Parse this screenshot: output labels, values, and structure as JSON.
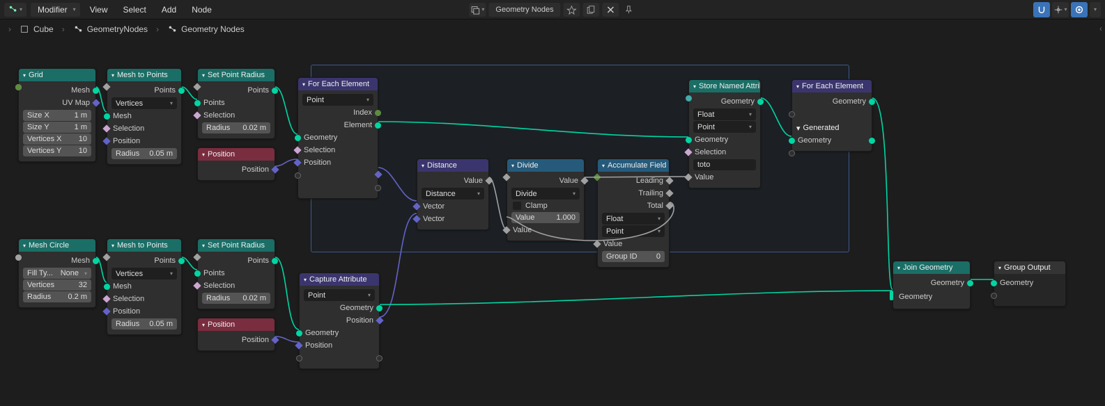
{
  "header": {
    "modifier_label": "Modifier",
    "menu": {
      "view": "View",
      "select": "Select",
      "add": "Add",
      "node": "Node"
    },
    "datablock": "Geometry Nodes"
  },
  "breadcrumb": {
    "a": "Cube",
    "b": "GeometryNodes",
    "c": "Geometry Nodes"
  },
  "nodes": {
    "grid": {
      "title": "Grid",
      "out_mesh": "Mesh",
      "out_uv": "UV Map",
      "sx_l": "Size X",
      "sx_v": "1 m",
      "sy_l": "Size Y",
      "sy_v": "1 m",
      "vx_l": "Vertices X",
      "vx_v": "10",
      "vy_l": "Vertices Y",
      "vy_v": "10"
    },
    "m2p1": {
      "title": "Mesh to Points",
      "out": "Points",
      "mode": "Vertices",
      "in_mesh": "Mesh",
      "in_sel": "Selection",
      "in_pos": "Position",
      "rad_l": "Radius",
      "rad_v": "0.05 m"
    },
    "spr1": {
      "title": "Set Point Radius",
      "out": "Points",
      "in_pts": "Points",
      "in_sel": "Selection",
      "rad_l": "Radius",
      "rad_v": "0.02 m"
    },
    "pos1": {
      "title": "Position",
      "out": "Position"
    },
    "foreach1": {
      "title": "For Each Element",
      "mode": "Point",
      "out_i": "Index",
      "out_e": "Element",
      "in_g": "Geometry",
      "in_s": "Selection",
      "in_p": "Position"
    },
    "dist": {
      "title": "Distance",
      "out": "Value",
      "mode": "Distance",
      "vec_a": "Vector",
      "vec_b": "Vector"
    },
    "div": {
      "title": "Divide",
      "out": "Value",
      "mode": "Divide",
      "clamp": "Clamp",
      "val_a_l": "Value",
      "val_a_v": "1.000",
      "val_b": "Value"
    },
    "accum": {
      "title": "Accumulate Field",
      "o1": "Leading",
      "o2": "Trailing",
      "o3": "Total",
      "t1": "Float",
      "t2": "Point",
      "in_val": "Value",
      "gid_l": "Group ID",
      "gid_v": "0"
    },
    "store": {
      "title": "Store Named Attrib...",
      "out": "Geometry",
      "t1": "Float",
      "t2": "Point",
      "in_g": "Geometry",
      "in_s": "Selection",
      "name": "toto",
      "in_v": "Value"
    },
    "foreach2": {
      "title": "For Each Element",
      "out_g": "Geometry",
      "gen": "Generated",
      "in_g": "Geometry"
    },
    "circle": {
      "title": "Mesh Circle",
      "out": "Mesh",
      "fill_l": "Fill Ty...",
      "fill_v": "None",
      "vx_l": "Vertices",
      "vx_v": "32",
      "rad_l": "Radius",
      "rad_v": "0.2 m"
    },
    "m2p2": {
      "title": "Mesh to Points",
      "out": "Points",
      "mode": "Vertices",
      "in_mesh": "Mesh",
      "in_sel": "Selection",
      "in_pos": "Position",
      "rad_l": "Radius",
      "rad_v": "0.05 m"
    },
    "spr2": {
      "title": "Set Point Radius",
      "out": "Points",
      "in_pts": "Points",
      "in_sel": "Selection",
      "rad_l": "Radius",
      "rad_v": "0.02 m"
    },
    "pos2": {
      "title": "Position",
      "out": "Position"
    },
    "cap": {
      "title": "Capture Attribute",
      "mode": "Point",
      "og": "Geometry",
      "op": "Position",
      "ig": "Geometry",
      "ip": "Position"
    },
    "join": {
      "title": "Join Geometry",
      "out": "Geometry",
      "in": "Geometry"
    },
    "out": {
      "title": "Group Output",
      "in": "Geometry"
    }
  }
}
